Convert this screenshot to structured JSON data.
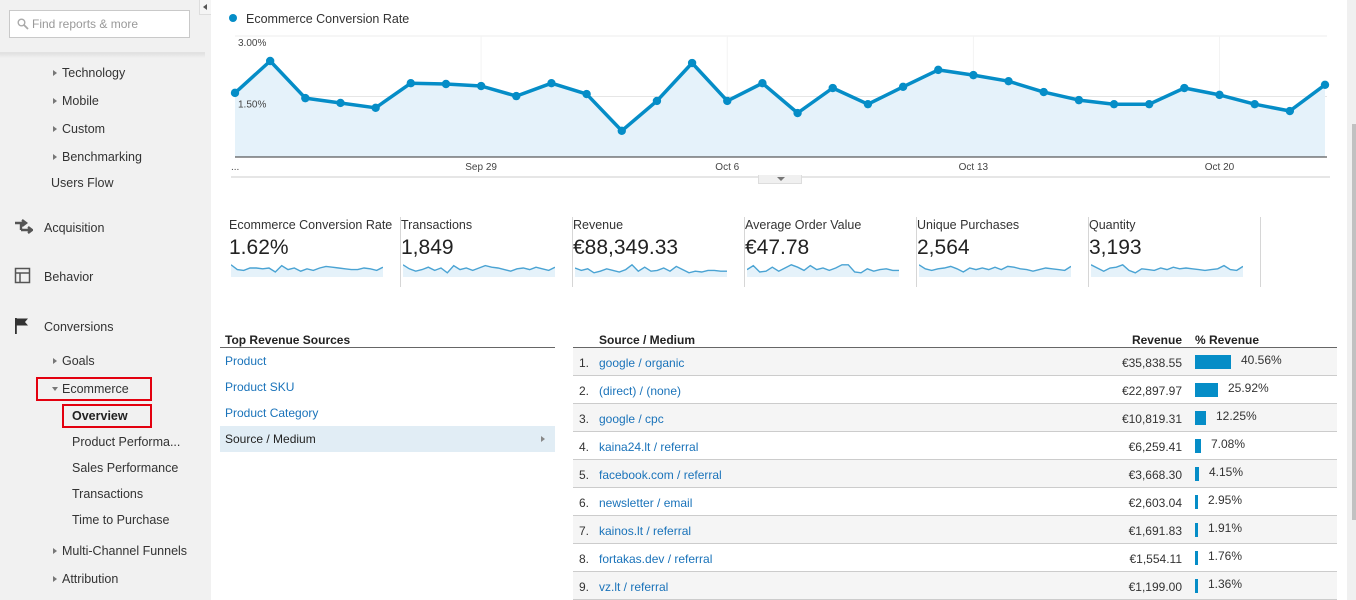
{
  "sidebar": {
    "search_placeholder": "Find reports & more",
    "audience_sub": [
      {
        "label": "Technology"
      },
      {
        "label": "Mobile"
      },
      {
        "label": "Custom"
      },
      {
        "label": "Benchmarking"
      }
    ],
    "users_flow": "Users Flow",
    "sections": [
      {
        "label": "Acquisition",
        "icon": "acquisition-arrows-icon"
      },
      {
        "label": "Behavior",
        "icon": "behavior-layout-icon"
      },
      {
        "label": "Conversions",
        "icon": "flag-icon"
      }
    ],
    "conversions": {
      "goals": "Goals",
      "ecommerce": "Ecommerce",
      "ecommerce_items": [
        {
          "label": "Overview",
          "selected": true
        },
        {
          "label": "Product Performa..."
        },
        {
          "label": "Sales Performance"
        },
        {
          "label": "Transactions"
        },
        {
          "label": "Time to Purchase"
        }
      ],
      "multi_channel": "Multi-Channel Funnels",
      "attribution": "Attribution"
    }
  },
  "chart_data": {
    "type": "area",
    "title": "Ecommerce Conversion Rate",
    "legend": [
      "Ecommerce Conversion Rate"
    ],
    "series_color": "#058dc7",
    "y_ticks": [
      "3.00%",
      "1.50%"
    ],
    "ylim": [
      0,
      3.0
    ],
    "x_ticks": [
      "...",
      "Sep 29",
      "Oct 6",
      "Oct 13",
      "Oct 20"
    ],
    "x_tick_indices": [
      0,
      7,
      14,
      21,
      28
    ],
    "x": [
      "Sep 22",
      "Sep 23",
      "Sep 24",
      "Sep 25",
      "Sep 26",
      "Sep 27",
      "Sep 28",
      "Sep 29",
      "Sep 30",
      "Oct 1",
      "Oct 2",
      "Oct 3",
      "Oct 4",
      "Oct 5",
      "Oct 6",
      "Oct 7",
      "Oct 8",
      "Oct 9",
      "Oct 10",
      "Oct 11",
      "Oct 12",
      "Oct 13",
      "Oct 14",
      "Oct 15",
      "Oct 16",
      "Oct 17",
      "Oct 18",
      "Oct 19",
      "Oct 20",
      "Oct 21",
      "Oct 22",
      "Oct 23"
    ],
    "values": [
      1.59,
      2.38,
      1.46,
      1.34,
      1.22,
      1.83,
      1.81,
      1.76,
      1.51,
      1.83,
      1.56,
      0.65,
      1.39,
      2.33,
      1.39,
      1.83,
      1.09,
      1.71,
      1.31,
      1.74,
      2.16,
      2.03,
      1.88,
      1.61,
      1.41,
      1.31,
      1.31,
      1.71,
      1.54,
      1.31,
      1.14,
      1.79
    ],
    "grid": true
  },
  "kpis": [
    {
      "label": "Ecommerce Conversion Rate",
      "value": "1.62%",
      "spark": [
        0.7,
        0.4,
        0.35,
        0.5,
        0.5,
        0.45,
        0.5,
        0.25,
        0.65,
        0.4,
        0.5,
        0.3,
        0.45,
        0.35,
        0.5,
        0.6,
        0.55,
        0.5,
        0.45,
        0.4,
        0.4,
        0.5,
        0.45,
        0.35,
        0.55
      ]
    },
    {
      "label": "Transactions",
      "value": "1,849",
      "spark": [
        0.7,
        0.45,
        0.3,
        0.4,
        0.55,
        0.35,
        0.5,
        0.2,
        0.65,
        0.4,
        0.5,
        0.35,
        0.5,
        0.65,
        0.55,
        0.5,
        0.4,
        0.3,
        0.45,
        0.5,
        0.4,
        0.55,
        0.45,
        0.35,
        0.55
      ]
    },
    {
      "label": "Revenue",
      "value": "€88,349.33",
      "spark": [
        0.5,
        0.35,
        0.45,
        0.2,
        0.3,
        0.45,
        0.35,
        0.25,
        0.4,
        0.7,
        0.3,
        0.55,
        0.3,
        0.35,
        0.5,
        0.3,
        0.6,
        0.4,
        0.2,
        0.3,
        0.25,
        0.35,
        0.35,
        0.3,
        0.3
      ]
    },
    {
      "label": "Average Order Value",
      "value": "€47.78",
      "spark": [
        0.4,
        0.65,
        0.25,
        0.3,
        0.55,
        0.3,
        0.5,
        0.7,
        0.55,
        0.35,
        0.65,
        0.4,
        0.5,
        0.35,
        0.5,
        0.7,
        0.7,
        0.25,
        0.2,
        0.45,
        0.3,
        0.4,
        0.45,
        0.35,
        0.35
      ]
    },
    {
      "label": "Unique Purchases",
      "value": "2,564",
      "spark": [
        0.7,
        0.45,
        0.35,
        0.45,
        0.5,
        0.6,
        0.45,
        0.25,
        0.5,
        0.4,
        0.5,
        0.4,
        0.55,
        0.4,
        0.6,
        0.55,
        0.45,
        0.4,
        0.3,
        0.4,
        0.5,
        0.45,
        0.4,
        0.35,
        0.6
      ]
    },
    {
      "label": "Quantity",
      "value": "3,193",
      "spark": [
        0.7,
        0.5,
        0.3,
        0.5,
        0.55,
        0.7,
        0.35,
        0.2,
        0.45,
        0.4,
        0.35,
        0.5,
        0.4,
        0.55,
        0.45,
        0.5,
        0.45,
        0.4,
        0.35,
        0.4,
        0.45,
        0.65,
        0.4,
        0.35,
        0.6
      ]
    }
  ],
  "top_revenue_sources": {
    "title": "Top Revenue Sources",
    "items": [
      {
        "label": "Product"
      },
      {
        "label": "Product SKU"
      },
      {
        "label": "Product Category"
      },
      {
        "label": "Source / Medium",
        "active": true
      }
    ]
  },
  "source_table": {
    "columns": [
      "Source / Medium",
      "Revenue",
      "% Revenue"
    ],
    "bar_color": "#058dc7",
    "rows": [
      {
        "rank": "1.",
        "name": "google / organic",
        "revenue": "€35,838.55",
        "pct": "40.56%",
        "pct_value": 40.56
      },
      {
        "rank": "2.",
        "name": "(direct) / (none)",
        "revenue": "€22,897.97",
        "pct": "25.92%",
        "pct_value": 25.92
      },
      {
        "rank": "3.",
        "name": "google / cpc",
        "revenue": "€10,819.31",
        "pct": "12.25%",
        "pct_value": 12.25
      },
      {
        "rank": "4.",
        "name": "kaina24.lt / referral",
        "revenue": "€6,259.41",
        "pct": "7.08%",
        "pct_value": 7.08
      },
      {
        "rank": "5.",
        "name": "facebook.com / referral",
        "revenue": "€3,668.30",
        "pct": "4.15%",
        "pct_value": 4.15
      },
      {
        "rank": "6.",
        "name": "newsletter / email",
        "revenue": "€2,603.04",
        "pct": "2.95%",
        "pct_value": 2.95
      },
      {
        "rank": "7.",
        "name": "kainos.lt / referral",
        "revenue": "€1,691.83",
        "pct": "1.91%",
        "pct_value": 1.91
      },
      {
        "rank": "8.",
        "name": "fortakas.dev / referral",
        "revenue": "€1,554.11",
        "pct": "1.76%",
        "pct_value": 1.76
      },
      {
        "rank": "9.",
        "name": "vz.lt / referral",
        "revenue": "€1,199.00",
        "pct": "1.36%",
        "pct_value": 1.36
      }
    ]
  }
}
